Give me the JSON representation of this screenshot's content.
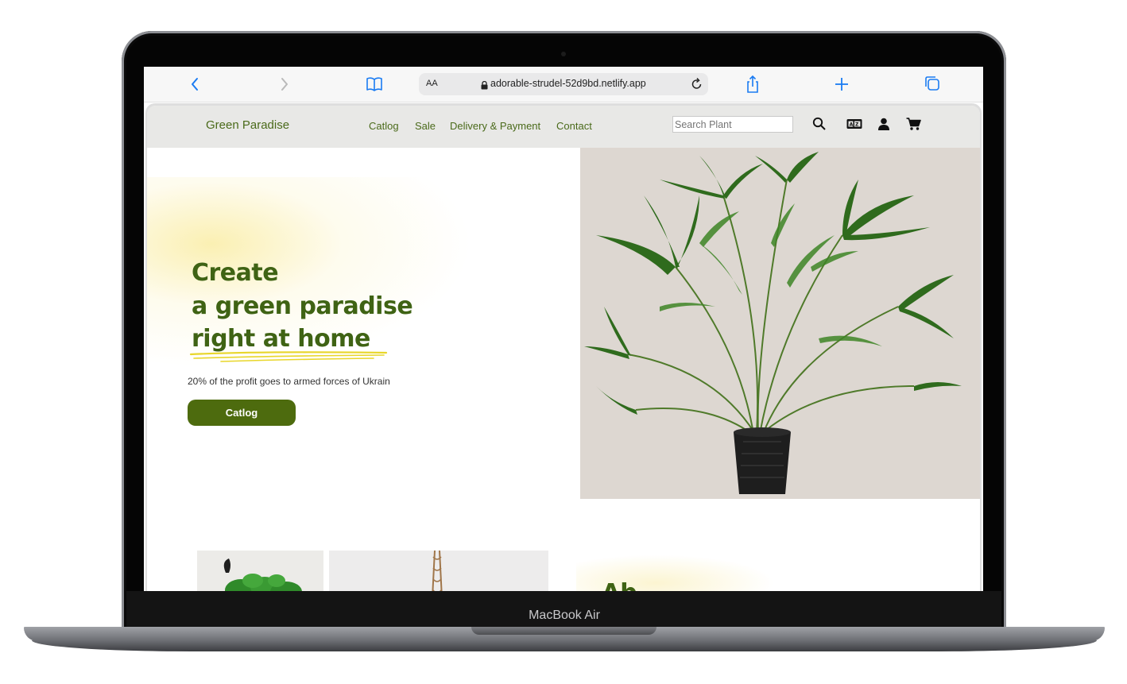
{
  "device": {
    "label": "MacBook Air"
  },
  "browser": {
    "address_aa": "AA",
    "url": "adorable-strudel-52d9bd.netlify.app"
  },
  "site": {
    "logo": "Green Paradise",
    "nav": [
      "Catlog",
      "Sale",
      "Delivery & Payment",
      "Contact"
    ],
    "search_placeholder": "Search Plant",
    "icons": [
      "search-icon",
      "id-card-icon",
      "user-icon",
      "cart-icon"
    ]
  },
  "hero": {
    "title_line1": "Create",
    "title_line2": "a green paradise",
    "title_line3": "right at home",
    "subtitle": "20% of the profit goes to armed forces of Ukrain",
    "button": "Catlog"
  },
  "next_section": {
    "heading_partial": "Ab"
  },
  "colors": {
    "brand_green": "#3f6314",
    "button_green": "#4d6b0e",
    "nav_bg": "#e8e8e6",
    "accent_blue": "#1a7bf2",
    "underline_yellow": "#e8d62a"
  }
}
